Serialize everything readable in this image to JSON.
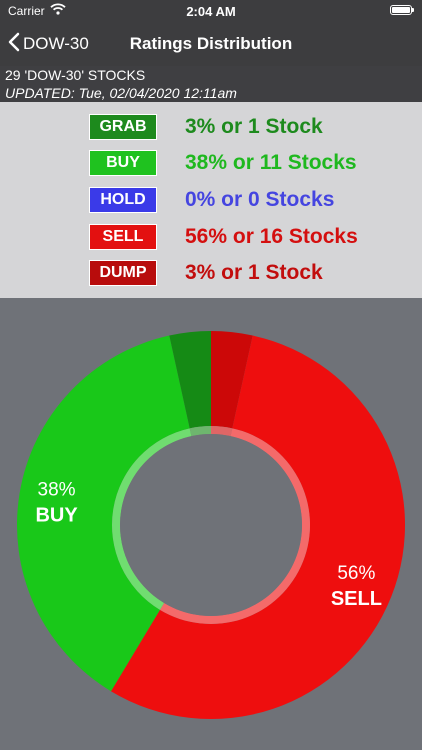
{
  "status_bar": {
    "carrier": "Carrier",
    "time": "2:04 AM"
  },
  "nav": {
    "back_label": "DOW-30",
    "title": "Ratings Distribution"
  },
  "info": {
    "count": "29 'DOW-30' STOCKS",
    "updated": "UPDATED: Tue, 02/04/2020 12:11am"
  },
  "legend": [
    {
      "key": "grab",
      "label": "GRAB",
      "text": "3% or 1 Stock",
      "badge_color": "#1d8a1d",
      "text_color": "#1d8a1d"
    },
    {
      "key": "buy",
      "label": "BUY",
      "text": "38% or 11 Stocks",
      "badge_color": "#1fc21f",
      "text_color": "#1fb81f"
    },
    {
      "key": "hold",
      "label": "HOLD",
      "text": "0% or 0 Stocks",
      "badge_color": "#3a3ae8",
      "text_color": "#4545e0"
    },
    {
      "key": "sell",
      "label": "SELL",
      "text": "56% or 16 Stocks",
      "badge_color": "#e31010",
      "text_color": "#d40f0f"
    },
    {
      "key": "dump",
      "label": "DUMP",
      "text": "3% or 1 Stock",
      "badge_color": "#b80c0c",
      "text_color": "#c20d0d"
    }
  ],
  "chart_data": {
    "type": "pie",
    "categories": [
      "GRAB",
      "BUY",
      "HOLD",
      "SELL",
      "DUMP"
    ],
    "values": [
      1,
      11,
      0,
      16,
      1
    ],
    "percent_labels": [
      {
        "category": "BUY",
        "percent": "38%",
        "label": "BUY"
      },
      {
        "category": "SELL",
        "percent": "56%",
        "label": "SELL"
      }
    ],
    "colors": {
      "GRAB": "#158a15",
      "BUY": "#19c819",
      "HOLD": "#3535e0",
      "SELL": "#ee0e0e",
      "DUMP": "#cc0808"
    }
  }
}
